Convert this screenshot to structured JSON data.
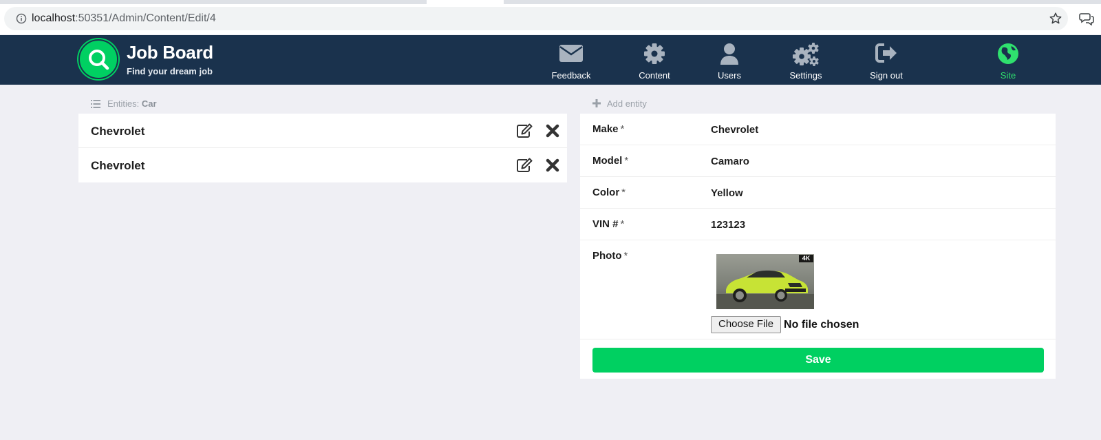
{
  "browser": {
    "url_host": "localhost",
    "url_path": ":50351/Admin/Content/Edit/4"
  },
  "header": {
    "brand_title": "Job Board",
    "brand_subtitle": "Find your dream job",
    "nav": [
      {
        "label": "Feedback",
        "icon": "envelope-icon"
      },
      {
        "label": "Content",
        "icon": "gear-icon"
      },
      {
        "label": "Users",
        "icon": "user-icon"
      },
      {
        "label": "Settings",
        "icon": "gears-icon"
      },
      {
        "label": "Sign out",
        "icon": "sign-out-icon"
      },
      {
        "label": "Site",
        "icon": "globe-icon",
        "active": true
      }
    ]
  },
  "entities": {
    "heading_prefix": "Entities:",
    "heading_entity": "Car",
    "items": [
      {
        "label": "Chevrolet"
      },
      {
        "label": "Chevrolet"
      }
    ]
  },
  "form": {
    "heading": "Add entity",
    "fields": [
      {
        "label": "Make",
        "value": "Chevrolet"
      },
      {
        "label": "Model",
        "value": "Camaro"
      },
      {
        "label": "Color",
        "value": "Yellow"
      },
      {
        "label": "VIN #",
        "value": "123123"
      }
    ],
    "photo_label": "Photo",
    "required_mark": "*",
    "photo_badge": "4K",
    "file_button": "Choose File",
    "file_status": "No file chosen",
    "save_label": "Save"
  },
  "colors": {
    "header_bg": "#1a324d",
    "accent": "#00d062",
    "page_bg": "#efeff4"
  }
}
